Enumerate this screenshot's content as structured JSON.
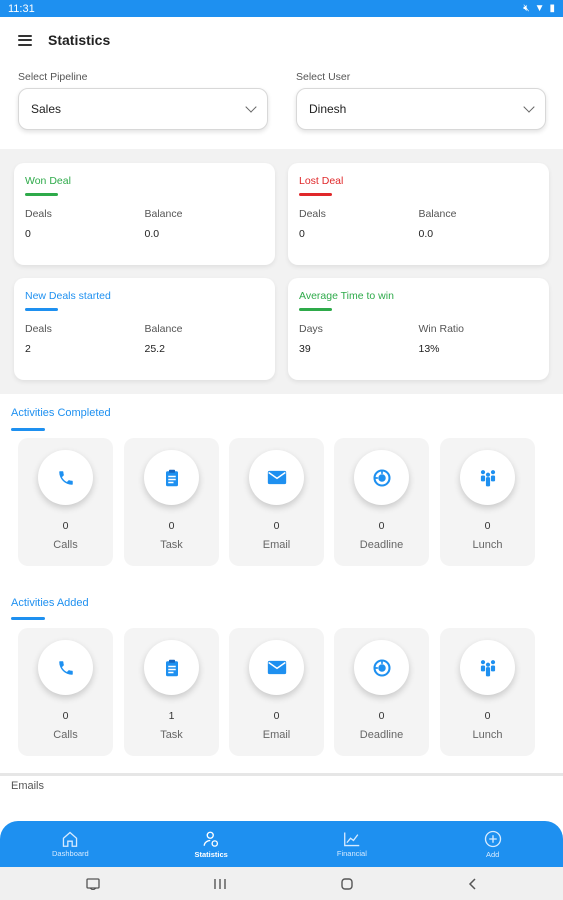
{
  "status_bar": {
    "time": "11:31"
  },
  "header": {
    "title": "Statistics"
  },
  "filters": {
    "pipeline": {
      "label": "Select Pipeline",
      "value": "Sales"
    },
    "user": {
      "label": "Select User",
      "value": "Dinesh"
    }
  },
  "cards": [
    {
      "title": "Won Deal",
      "color": "#2eaa4a",
      "col1_label": "Deals",
      "col1_value": "0",
      "col2_label": "Balance",
      "col2_value": "0.0"
    },
    {
      "title": "Lost Deal",
      "color": "#e0282a",
      "col1_label": "Deals",
      "col1_value": "0",
      "col2_label": "Balance",
      "col2_value": "0.0"
    },
    {
      "title": "New Deals started",
      "color": "#1e90f0",
      "col1_label": "Deals",
      "col1_value": "2",
      "col2_label": "Balance",
      "col2_value": "25.2"
    },
    {
      "title": "Average Time to win",
      "color": "#2eaa4a",
      "col1_label": "Days",
      "col1_value": "39",
      "col2_label": "Win Ratio",
      "col2_value": "13%"
    }
  ],
  "activities_completed": {
    "title": "Activities Completed",
    "items": [
      {
        "icon": "phone-icon",
        "count": "0",
        "label": "Calls"
      },
      {
        "icon": "clipboard-icon",
        "count": "0",
        "label": "Task"
      },
      {
        "icon": "envelope-icon",
        "count": "0",
        "label": "Email"
      },
      {
        "icon": "deadline-icon",
        "count": "0",
        "label": "Deadline"
      },
      {
        "icon": "lunch-icon",
        "count": "0",
        "label": "Lunch"
      }
    ]
  },
  "activities_added": {
    "title": "Activities Added",
    "items": [
      {
        "icon": "phone-icon",
        "count": "0",
        "label": "Calls"
      },
      {
        "icon": "clipboard-icon",
        "count": "1",
        "label": "Task"
      },
      {
        "icon": "envelope-icon",
        "count": "0",
        "label": "Email"
      },
      {
        "icon": "deadline-icon",
        "count": "0",
        "label": "Deadline"
      },
      {
        "icon": "lunch-icon",
        "count": "0",
        "label": "Lunch"
      }
    ]
  },
  "emails": {
    "label": "Emails"
  },
  "bottom_nav": [
    {
      "label": "Dashboard",
      "icon": "home-icon"
    },
    {
      "label": "Statistics",
      "icon": "person-stats-icon",
      "active": true
    },
    {
      "label": "Financial",
      "icon": "chart-icon"
    },
    {
      "label": "Add",
      "icon": "plus-circle-icon"
    }
  ],
  "colors": {
    "primary": "#1e90f0",
    "won": "#2eaa4a",
    "lost": "#e0282a"
  }
}
